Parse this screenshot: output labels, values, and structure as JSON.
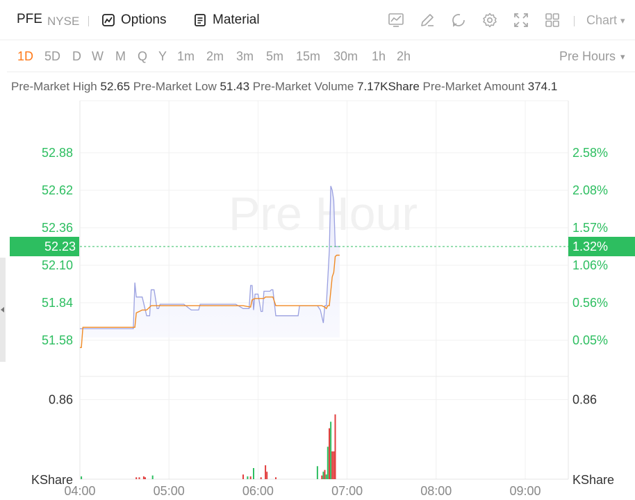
{
  "header": {
    "symbol": "PFE",
    "exchange": "NYSE",
    "options_label": "Options",
    "material_label": "Material",
    "chart_type_label": "Chart"
  },
  "periods": {
    "items": [
      "1D",
      "5D",
      "D",
      "W",
      "M",
      "Q",
      "Y",
      "1m",
      "2m",
      "3m",
      "5m",
      "15m",
      "30m",
      "1h",
      "2h"
    ],
    "active": "1D",
    "session_label": "Pre Hours"
  },
  "stats": {
    "high_label": "Pre-Market High",
    "high_value": "52.65",
    "low_label": "Pre-Market Low",
    "low_value": "51.43",
    "volume_label": "Pre-Market Volume",
    "volume_value": "7.17KShare",
    "amount_label": "Pre-Market Amount",
    "amount_value": "374.1"
  },
  "colors": {
    "up": "#2dbe60",
    "down": "#e23e3e",
    "price_line": "#9aa0e0",
    "avg_line": "#f08a24",
    "accent": "#ff7a1a",
    "grid": "#f0f0f0"
  },
  "chart_data": {
    "type": "line",
    "watermark": "Pre Hour",
    "x_ticks": [
      "04:00",
      "05:00",
      "06:00",
      "07:00",
      "08:00",
      "09:00"
    ],
    "price_ticks": [
      "52.88",
      "52.62",
      "52.36",
      "52.10",
      "51.84",
      "51.58"
    ],
    "pct_ticks": [
      "2.58%",
      "2.08%",
      "1.57%",
      "1.06%",
      "0.56%",
      "0.05%"
    ],
    "current_price": "52.23",
    "current_pct": "1.32%",
    "volume_tick": "0.86",
    "volume_unit": "KShare",
    "ylim": [
      51.45,
      53.0
    ],
    "volume_max": 1.05,
    "series": [
      {
        "key": "price",
        "x": [
          "04:00",
          "04:01",
          "04:36",
          "04:37",
          "04:38",
          "04:40",
          "04:42",
          "04:45",
          "04:47",
          "04:48",
          "04:50",
          "04:52",
          "04:53",
          "04:54",
          "04:56",
          "05:00",
          "05:10",
          "05:15",
          "05:20",
          "05:21",
          "05:25",
          "05:35",
          "05:45",
          "05:50",
          "05:54",
          "05:55",
          "05:56",
          "05:57",
          "05:58",
          "06:00",
          "06:02",
          "06:03",
          "06:04",
          "06:08",
          "06:09",
          "06:10",
          "06:12",
          "06:20",
          "06:27",
          "06:28",
          "06:40",
          "06:42",
          "06:44",
          "06:45",
          "06:46",
          "06:48",
          "06:49",
          "06:50",
          "06:51",
          "06:52",
          "06:53",
          "06:54",
          "06:55"
        ],
        "values": [
          51.66,
          51.66,
          51.66,
          51.98,
          51.88,
          51.88,
          51.88,
          51.75,
          51.75,
          51.93,
          51.93,
          51.8,
          51.8,
          51.83,
          51.83,
          51.83,
          51.83,
          51.79,
          51.79,
          51.83,
          51.83,
          51.83,
          51.83,
          51.8,
          51.8,
          51.96,
          51.96,
          51.79,
          51.9,
          51.9,
          51.78,
          51.78,
          51.92,
          51.92,
          51.93,
          51.93,
          51.75,
          51.75,
          51.75,
          51.82,
          51.82,
          51.79,
          51.7,
          51.82,
          51.82,
          52.2,
          52.65,
          52.62,
          52.55,
          52.23,
          52.23,
          52.23,
          52.23
        ],
        "name": ""
      },
      {
        "key": "avg",
        "x": [
          "04:00",
          "04:01",
          "04:02",
          "04:10",
          "04:30",
          "04:37",
          "04:38",
          "04:40",
          "04:42",
          "04:45",
          "04:48",
          "05:00",
          "05:20",
          "05:40",
          "05:50",
          "05:55",
          "05:56",
          "05:58",
          "06:00",
          "06:04",
          "06:05",
          "06:10",
          "06:12",
          "06:14",
          "06:20",
          "06:40",
          "06:43",
          "06:45",
          "06:46",
          "06:47",
          "06:48",
          "06:49",
          "06:50",
          "06:51",
          "06:52",
          "06:53",
          "06:55"
        ],
        "values": [
          51.53,
          51.53,
          51.67,
          51.67,
          51.67,
          51.67,
          51.77,
          51.78,
          51.79,
          51.79,
          51.82,
          51.82,
          51.82,
          51.82,
          51.82,
          51.81,
          51.86,
          51.87,
          51.87,
          51.87,
          51.88,
          51.88,
          51.82,
          51.82,
          51.82,
          51.82,
          51.82,
          51.81,
          51.8,
          51.82,
          51.82,
          51.92,
          52.02,
          52.05,
          52.16,
          52.17,
          52.17
        ],
        "name": ""
      }
    ],
    "volume": [
      {
        "x": "04:01",
        "v": 0.03,
        "dir": "up"
      },
      {
        "x": "04:38",
        "v": 0.02,
        "dir": "down"
      },
      {
        "x": "04:40",
        "v": 0.02,
        "dir": "down"
      },
      {
        "x": "04:43",
        "v": 0.03,
        "dir": "down"
      },
      {
        "x": "04:44",
        "v": 0.02,
        "dir": "down"
      },
      {
        "x": "04:49",
        "v": 0.04,
        "dir": "up"
      },
      {
        "x": "05:50",
        "v": 0.05,
        "dir": "down"
      },
      {
        "x": "05:53",
        "v": 0.03,
        "dir": "up"
      },
      {
        "x": "05:55",
        "v": 0.03,
        "dir": "down"
      },
      {
        "x": "05:57",
        "v": 0.12,
        "dir": "up"
      },
      {
        "x": "06:02",
        "v": 0.02,
        "dir": "down"
      },
      {
        "x": "06:05",
        "v": 0.15,
        "dir": "down"
      },
      {
        "x": "06:06",
        "v": 0.08,
        "dir": "down"
      },
      {
        "x": "06:12",
        "v": 0.02,
        "dir": "down"
      },
      {
        "x": "06:40",
        "v": 0.14,
        "dir": "up"
      },
      {
        "x": "06:43",
        "v": 0.04,
        "dir": "down"
      },
      {
        "x": "06:44",
        "v": 0.08,
        "dir": "up"
      },
      {
        "x": "06:45",
        "v": 0.1,
        "dir": "down"
      },
      {
        "x": "06:46",
        "v": 0.05,
        "dir": "up"
      },
      {
        "x": "06:47",
        "v": 0.35,
        "dir": "up"
      },
      {
        "x": "06:48",
        "v": 0.55,
        "dir": "down"
      },
      {
        "x": "06:49",
        "v": 0.62,
        "dir": "up"
      },
      {
        "x": "06:50",
        "v": 0.3,
        "dir": "down"
      },
      {
        "x": "06:51",
        "v": 0.3,
        "dir": "down"
      },
      {
        "x": "06:52",
        "v": 0.7,
        "dir": "down"
      }
    ]
  }
}
